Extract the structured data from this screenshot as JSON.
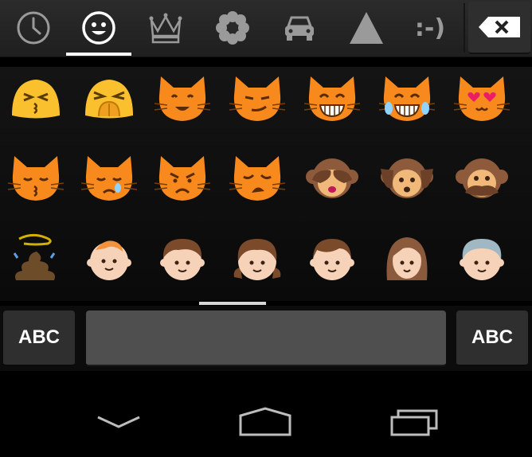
{
  "tabs": [
    {
      "name": "recent-icon",
      "active": false
    },
    {
      "name": "smiley-icon",
      "active": true
    },
    {
      "name": "crown-icon",
      "active": false
    },
    {
      "name": "flower-icon",
      "active": false
    },
    {
      "name": "car-icon",
      "active": false
    },
    {
      "name": "triangle-icon",
      "active": false
    },
    {
      "name": "emoticon-text-icon",
      "label": ":-)",
      "active": false
    }
  ],
  "backspace": {
    "icon": "backspace-icon"
  },
  "emojis": [
    [
      "kissing-face",
      "persevering-face",
      "smiling-cat",
      "smirking-cat",
      "grinning-cat",
      "cat-with-tears-of-joy",
      "heart-eyes-cat"
    ],
    [
      "kissing-cat",
      "crying-cat",
      "pouting-cat",
      "weary-cat",
      "see-no-evil-monkey",
      "hear-no-evil-monkey",
      "speak-no-evil-monkey"
    ],
    [
      "pile-of-poo",
      "baby",
      "boy",
      "girl",
      "man",
      "woman",
      "older-person"
    ]
  ],
  "keys": {
    "abc_left": "ABC",
    "abc_right": "ABC"
  },
  "nav": {
    "back": "back-icon",
    "home": "home-icon",
    "recents": "recent-apps-icon"
  },
  "colors": {
    "accent": "#ffffff",
    "cat": "#f8891d",
    "face": "#fbc02d",
    "skin": "#f6d2b8",
    "monkey": "#8d5a3b"
  }
}
